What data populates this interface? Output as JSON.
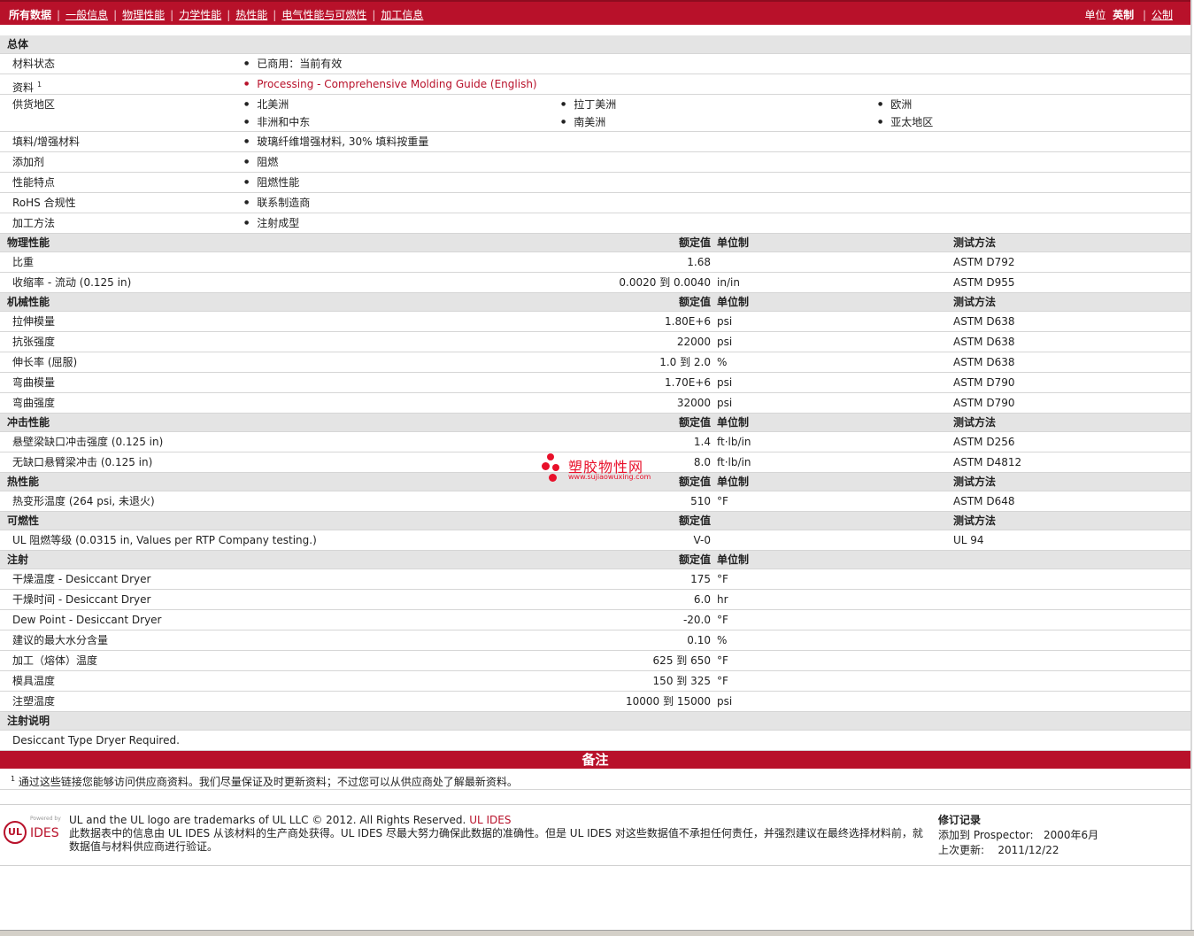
{
  "topbar": {
    "tabs": [
      "所有数据",
      "一般信息",
      "物理性能",
      "力学性能",
      "热性能",
      "电气性能与可燃性",
      "加工信息"
    ],
    "units_label": "单位",
    "unit_selected": "英制",
    "unit_other": "公制"
  },
  "general": {
    "title": "总体",
    "material_status": {
      "label": "材料状态",
      "value": "已商用：当前有效"
    },
    "document": {
      "label": "资料",
      "sup": "1",
      "value": "Processing - Comprehensive Molding Guide (English)"
    },
    "regions": {
      "label": "供货地区",
      "items": [
        "北美洲",
        "拉丁美洲",
        "欧洲",
        "非洲和中东",
        "南美洲",
        "亚太地区"
      ]
    },
    "filler": {
      "label": "填料/增强材料",
      "value": "玻璃纤维增强材料, 30% 填料按重量"
    },
    "additive": {
      "label": "添加剂",
      "value": "阻燃"
    },
    "features": {
      "label": "性能特点",
      "value": "阻燃性能"
    },
    "rohs": {
      "label": "RoHS 合规性",
      "value": "联系制造商"
    },
    "process": {
      "label": "加工方法",
      "value": "注射成型"
    }
  },
  "headers": {
    "value": "额定值",
    "unit": "单位制",
    "method": "测试方法"
  },
  "sections": {
    "physical": {
      "title": "物理性能",
      "rows": [
        {
          "label": "比重",
          "value": "1.68",
          "unit": "",
          "method": "ASTM D792"
        },
        {
          "label": "收缩率  - 流动  (0.125 in)",
          "value": "0.0020 到  0.0040",
          "unit": "in/in",
          "method": "ASTM D955"
        }
      ]
    },
    "mechanical": {
      "title": "机械性能",
      "rows": [
        {
          "label": "拉伸模量",
          "value": "1.80E+6",
          "unit": "psi",
          "method": "ASTM D638"
        },
        {
          "label": "抗张强度",
          "value": "22000",
          "unit": "psi",
          "method": "ASTM D638"
        },
        {
          "label": "伸长率  (屈服)",
          "value": "1.0 到  2.0",
          "unit": "%",
          "method": "ASTM D638"
        },
        {
          "label": "弯曲模量",
          "value": "1.70E+6",
          "unit": "psi",
          "method": "ASTM D790"
        },
        {
          "label": "弯曲强度",
          "value": "32000",
          "unit": "psi",
          "method": "ASTM D790"
        }
      ]
    },
    "impact": {
      "title": "冲击性能",
      "rows": [
        {
          "label": "悬壁梁缺口冲击强度  (0.125 in)",
          "value": "1.4",
          "unit": "ft·lb/in",
          "method": "ASTM D256"
        },
        {
          "label": "无缺口悬臂梁冲击  (0.125 in)",
          "value": "8.0",
          "unit": "ft·lb/in",
          "method": "ASTM D4812"
        }
      ]
    },
    "thermal": {
      "title": "热性能",
      "rows": [
        {
          "label": "热变形温度  (264 psi, 未退火)",
          "value": "510",
          "unit": "°F",
          "method": "ASTM D648"
        }
      ]
    },
    "flammability": {
      "title": "可燃性",
      "rows": [
        {
          "label": "UL 阻燃等级  (0.0315 in, Values per RTP Company testing.)",
          "value": "V-0",
          "unit": "",
          "method": "UL 94"
        }
      ]
    },
    "injection": {
      "title": "注射",
      "rows": [
        {
          "label": "干燥温度  - Desiccant Dryer",
          "value": "175",
          "unit": "°F",
          "method": ""
        },
        {
          "label": "干燥时间  - Desiccant Dryer",
          "value": "6.0",
          "unit": "hr",
          "method": ""
        },
        {
          "label": "Dew Point - Desiccant Dryer",
          "value": "-20.0",
          "unit": "°F",
          "method": ""
        },
        {
          "label": "建议的最大水分含量",
          "value": "0.10",
          "unit": "%",
          "method": ""
        },
        {
          "label": "加工（熔体）温度",
          "value": "625 到  650",
          "unit": "°F",
          "method": ""
        },
        {
          "label": "模具温度",
          "value": "150 到  325",
          "unit": "°F",
          "method": ""
        },
        {
          "label": "注塑温度",
          "value": "10000 到  15000",
          "unit": "psi",
          "method": ""
        }
      ]
    }
  },
  "injection_notes": {
    "title": "注射说明",
    "text": "Desiccant Type Dryer Required."
  },
  "remarks": {
    "banner": "备注",
    "sup": "1",
    "text": "通过这些链接您能够访问供应商资料。我们尽量保证及时更新资料；不过您可以从供应商处了解最新资料。"
  },
  "footer": {
    "logo": {
      "ul": "UL",
      "powered": "Powered by",
      "ides": "IDES"
    },
    "trademark": "UL and the UL logo are trademarks of UL LLC © 2012. All Rights Reserved.",
    "trademark_link": "UL IDES",
    "disclaimer": "此数据表中的信息由  UL IDES 从该材料的生产商处获得。UL IDES 尽最大努力确保此数据的准确性。但是  UL IDES 对这些数据值不承担任何责任，并强烈建议在最终选择材料前，就数据值与材料供应商进行验证。",
    "revision": {
      "title": "修订记录",
      "added_label": "添加到  Prospector:",
      "added_value": "2000年6月",
      "updated_label": "上次更新:",
      "updated_value": "2011/12/22"
    }
  },
  "watermark": {
    "title": "塑胶物性网",
    "url": "www.sujiaowuxing.com"
  },
  "colors": {
    "brand_red": "#b8112a",
    "section_gray": "#e4e4e4"
  }
}
